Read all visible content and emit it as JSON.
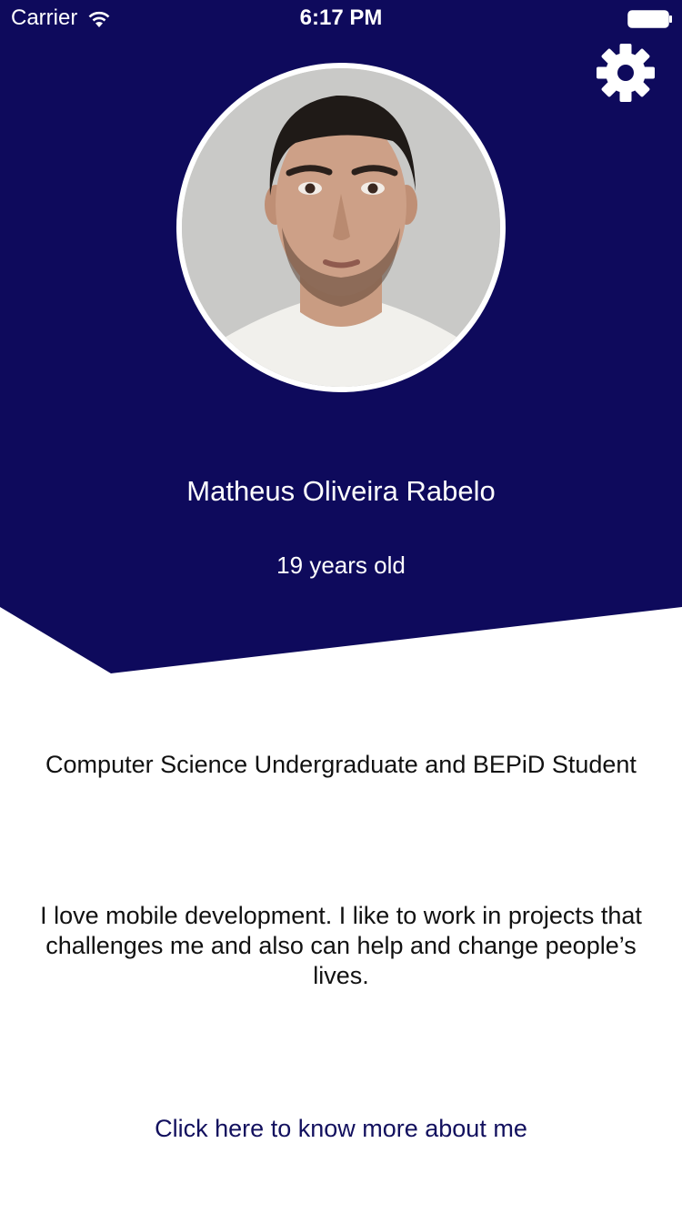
{
  "status_bar": {
    "carrier": "Carrier",
    "time": "6:17 PM"
  },
  "icons": {
    "wifi": "wifi-icon",
    "battery": "battery-icon",
    "settings": "gear-icon"
  },
  "profile": {
    "name": "Matheus Oliveira Rabelo",
    "age": "19 years old",
    "title": "Computer Science Undergraduate and BEPiD Student",
    "bio": "I love mobile development. I like to work in projects that challenges me and also can help and change people’s lives.",
    "more_link": "Click here to know more about me"
  },
  "colors": {
    "header_background": "#0e0a5c",
    "link": "#12105e",
    "text_on_header": "#ffffff",
    "body_text": "#111111"
  }
}
